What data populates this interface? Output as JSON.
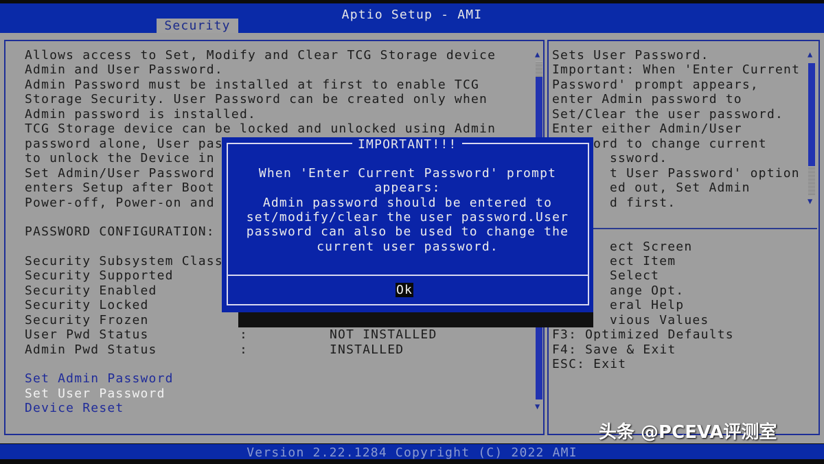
{
  "header": {
    "title": "Aptio Setup - AMI",
    "tab": "Security"
  },
  "left": {
    "description": [
      "Allows access to Set, Modify and Clear TCG Storage device",
      "Admin and User Password.",
      "Admin Password must be installed at first to enable TCG",
      "Storage Security. User Password can be created only when",
      "Admin password is installed.",
      "TCG Storage device can be locked and unlocked using Admin",
      "password alone, User pas",
      "to unlock the Device in",
      "Set Admin/User Password",
      "enters Setup after Boot",
      "Power-off, Power-on and"
    ],
    "section_label": "PASSWORD CONFIGURATION:",
    "fields": [
      {
        "label": "Security Subsystem Class",
        "sep": "",
        "value": ""
      },
      {
        "label": "Security Supported",
        "sep": "",
        "value": ""
      },
      {
        "label": "Security Enabled",
        "sep": "",
        "value": ""
      },
      {
        "label": "Security Locked",
        "sep": "",
        "value": ""
      },
      {
        "label": "Security Frozen",
        "sep": "",
        "value": ""
      },
      {
        "label": "User Pwd Status",
        "sep": ":",
        "value": "NOT INSTALLED"
      },
      {
        "label": "Admin Pwd Status",
        "sep": ":",
        "value": "INSTALLED"
      }
    ],
    "actions": [
      "Set Admin Password",
      "Set User Password",
      "Device Reset"
    ],
    "selected_action": "Set User Password"
  },
  "right": {
    "help": [
      "Sets User Password.",
      "Important: When 'Enter Current",
      "Password' prompt appears,",
      "enter Admin password to",
      "Set/Clear the user password.",
      "Enter either Admin/User",
      "ord to change current",
      "ssword.",
      "t User Password' option",
      "ed out, Set Admin",
      "d first."
    ],
    "keys": [
      "ect Screen",
      "ect Item",
      "Select",
      "ange Opt.",
      "eral Help",
      "vious Values",
      "F3: Optimized Defaults",
      "F4: Save & Exit",
      "ESC: Exit"
    ]
  },
  "dialog": {
    "title": "IMPORTANT!!!",
    "lines": [
      "When 'Enter Current Password' prompt",
      "appears:",
      "Admin password should be entered to",
      "set/modify/clear the user password.User",
      "password can also be used to change the",
      "current user password."
    ],
    "ok": "Ok"
  },
  "footer": {
    "version": "Version 2.22.1284 Copyright (C) 2022 AMI"
  },
  "watermark": "头条 @PCEVA评测室",
  "colors": {
    "bar": "#0a2aa8",
    "panel": "#9e9e9e",
    "link": "#1f2b99",
    "selected": "#f2f2f2"
  }
}
